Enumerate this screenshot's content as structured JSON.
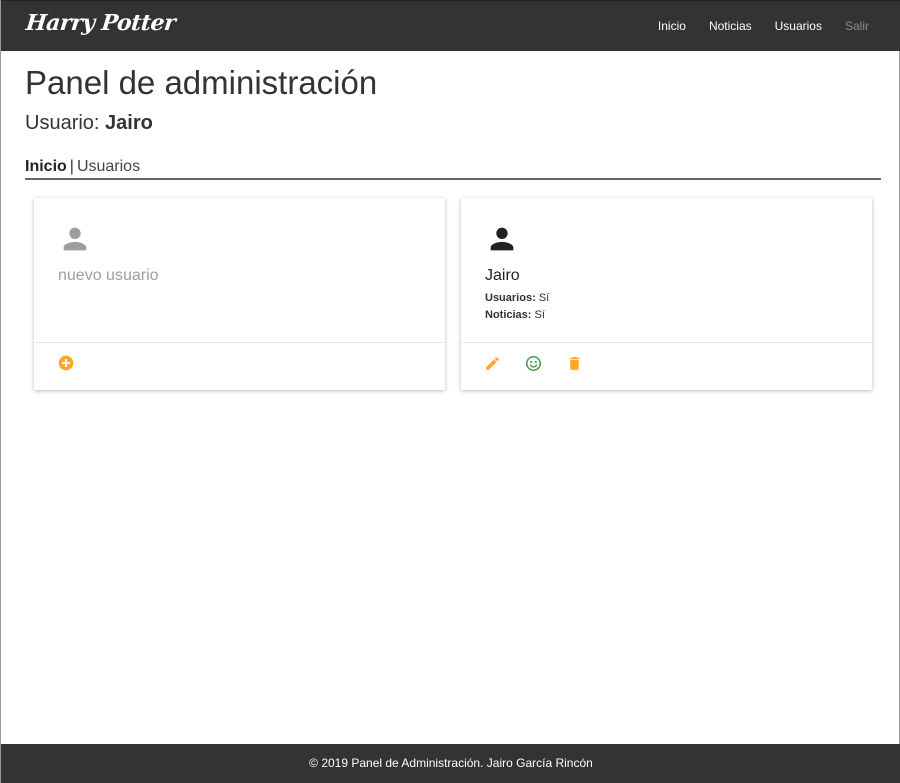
{
  "navbar": {
    "brand": "Harry Potter",
    "links": [
      {
        "label": "Inicio"
      },
      {
        "label": "Noticias"
      },
      {
        "label": "Usuarios"
      },
      {
        "label": "Salir"
      }
    ]
  },
  "page": {
    "title": "Panel de administración",
    "user_prefix": "Usuario: ",
    "user_name": "Jairo"
  },
  "breadcrumb": {
    "active": "Inicio",
    "separator": "|",
    "next": "Usuarios"
  },
  "cards": [
    {
      "name": "nuevo usuario",
      "avatar_color": "#9e9e9e",
      "actions": [
        {
          "icon": "add-circle-icon",
          "color": "#ffa726"
        }
      ]
    },
    {
      "name": "Jairo",
      "avatar_color": "#222222",
      "permissions": [
        {
          "label": "Usuarios:",
          "value": "Sí"
        },
        {
          "label": "Noticias:",
          "value": "Sí"
        }
      ],
      "actions": [
        {
          "icon": "pencil-icon",
          "color": "#ffa726"
        },
        {
          "icon": "smiley-icon",
          "color": "#43a047"
        },
        {
          "icon": "trash-icon",
          "color": "#ffa726"
        }
      ]
    }
  ],
  "footer": {
    "text": "© 2019 Panel de Administración. Jairo García Rincón"
  },
  "colors": {
    "navbar_bg": "#333333",
    "accent_orange": "#ffa726",
    "accent_green": "#43a047"
  }
}
